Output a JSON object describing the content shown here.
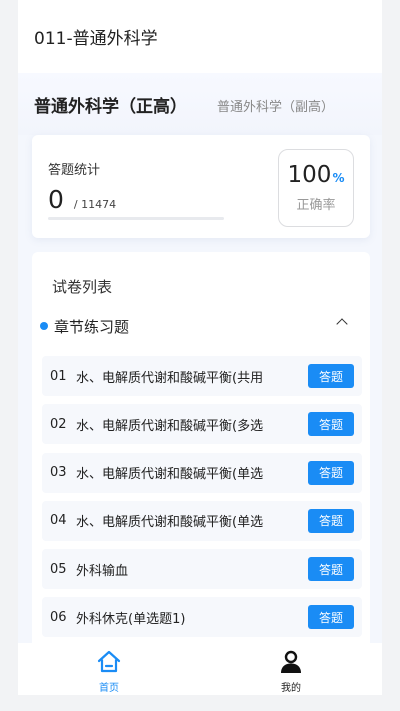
{
  "header": {
    "title": "011-普通外科学"
  },
  "levels": {
    "active": "普通外科学（正高）",
    "other": "普通外科学（副高）"
  },
  "stats": {
    "title": "答题统计",
    "count": "0",
    "total": "/ 11474",
    "progress_fraction": 0,
    "rate_value": "100",
    "rate_unit": "%",
    "rate_label": "正确率"
  },
  "list": {
    "title": "试卷列表",
    "section": "章节练习题",
    "items": [
      {
        "num": "01",
        "title": "水、电解质代谢和酸碱平衡(共用",
        "button": "答题"
      },
      {
        "num": "02",
        "title": "水、电解质代谢和酸碱平衡(多选",
        "button": "答题"
      },
      {
        "num": "03",
        "title": "水、电解质代谢和酸碱平衡(单选",
        "button": "答题"
      },
      {
        "num": "04",
        "title": "水、电解质代谢和酸碱平衡(单选",
        "button": "答题"
      },
      {
        "num": "05",
        "title": "外科输血",
        "button": "答题"
      },
      {
        "num": "06",
        "title": "外科休克(单选题1)",
        "button": "答题"
      }
    ]
  },
  "tabbar": {
    "home_label": "首页",
    "home_icon": "home-icon",
    "mine_label": "我的",
    "mine_icon": "user-icon"
  },
  "colors": {
    "accent": "#1a8cf5",
    "background": "#f4f7fd"
  }
}
